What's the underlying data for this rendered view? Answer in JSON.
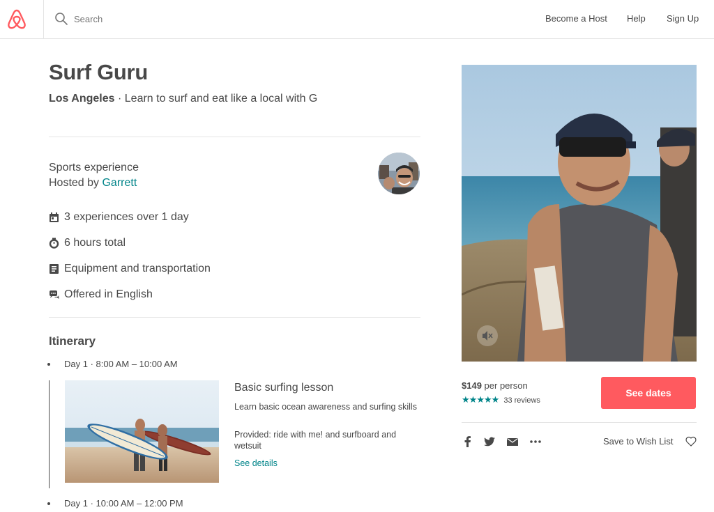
{
  "header": {
    "search_placeholder": "Search",
    "nav": {
      "become_host": "Become a Host",
      "help": "Help",
      "sign_up": "Sign Up"
    }
  },
  "listing": {
    "title": "Surf Guru",
    "city": "Los Angeles",
    "tagline": " · Learn to surf and eat like a local with G",
    "experience_type": "Sports experience",
    "hosted_by_prefix": "Hosted by ",
    "host_name": "Garrett",
    "features": [
      {
        "icon": "calendar-icon",
        "text": "3 experiences over 1 day"
      },
      {
        "icon": "clock-icon",
        "text": "6 hours total"
      },
      {
        "icon": "list-icon",
        "text": "Equipment and transportation"
      },
      {
        "icon": "speech-bubble-icon",
        "text": "Offered in English"
      }
    ]
  },
  "itinerary": {
    "heading": "Itinerary",
    "days": [
      {
        "time": "Day 1 · 8:00 AM – 10:00 AM",
        "title": "Basic surfing lesson",
        "description": "Learn basic ocean awareness and surfing skills",
        "provided": "Provided: ride with me! and surfboard and wetsuit",
        "see_details": "See details"
      },
      {
        "time": "Day 1 · 10:00 AM – 12:00 PM"
      }
    ]
  },
  "booking": {
    "price": "$149",
    "per_person": "per person",
    "rating_stars": 5,
    "reviews": "33 reviews",
    "see_dates": "See dates",
    "save_to_wishlist": "Save to Wish List"
  },
  "colors": {
    "brand": "#ff5a5f",
    "link": "#008489",
    "text": "#484848",
    "divider": "#e4e4e4"
  }
}
